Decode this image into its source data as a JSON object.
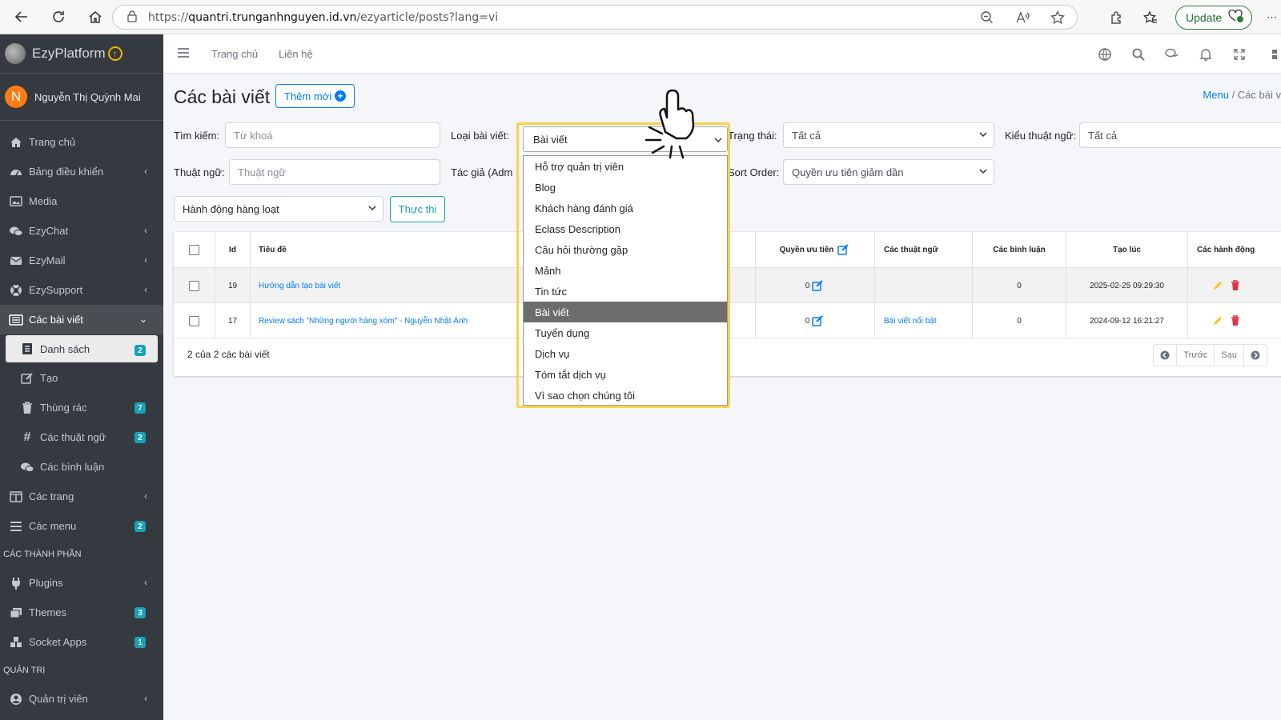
{
  "browser": {
    "url_prefix": "https://",
    "url_host": "quantri.trunganhnguyen.id.vn",
    "url_path": "/ezyarticle/posts?lang=vi",
    "update_label": "Update"
  },
  "sidebar": {
    "brand": "EzyPlatform",
    "user_initial": "N",
    "user_name": "Nguyễn Thị Quỳnh Mai",
    "items": [
      {
        "label": "Trang chủ",
        "icon": "home-icon"
      },
      {
        "label": "Bảng điều khiển",
        "icon": "dashboard-icon"
      },
      {
        "label": "Media",
        "icon": "image-icon"
      },
      {
        "label": "EzyChat",
        "icon": "chat-icon"
      },
      {
        "label": "EzyMail",
        "icon": "mail-icon"
      },
      {
        "label": "EzySupport",
        "icon": "support-icon"
      },
      {
        "label": "Các bài viết",
        "icon": "newspaper-icon"
      },
      {
        "label": "Danh sách",
        "icon": "list-icon",
        "badge": "2"
      },
      {
        "label": "Tạo",
        "icon": "edit-icon"
      },
      {
        "label": "Thùng rác",
        "icon": "trash-icon",
        "badge": "7"
      },
      {
        "label": "Các thuật ngữ",
        "icon": "hashtag-icon",
        "badge": "2"
      },
      {
        "label": "Các bình luận",
        "icon": "comments-icon"
      },
      {
        "label": "Các trang",
        "icon": "columns-icon"
      },
      {
        "label": "Các menu",
        "icon": "bars-icon",
        "badge": "2"
      },
      {
        "label": "Plugins",
        "icon": "plug-icon"
      },
      {
        "label": "Themes",
        "icon": "themes-icon",
        "badge": "3"
      },
      {
        "label": "Socket Apps",
        "icon": "cubes-icon",
        "badge": "1"
      },
      {
        "label": "Quản trị viên",
        "icon": "user-circle-icon"
      }
    ],
    "section_components": "CÁC THÀNH PHẦN",
    "section_admin": "QUẢN TRỊ"
  },
  "topnav": {
    "home": "Trang chủ",
    "contact": "Liên hệ"
  },
  "page": {
    "title": "Các bài viết",
    "add_new": "Thêm mới",
    "breadcrumb_menu": "Menu",
    "breadcrumb_current": "Các bài v"
  },
  "filters": {
    "search_label": "Tìm kiếm:",
    "search_placeholder": "Từ khoá",
    "type_label": "Loại bài viết:",
    "type_value": "Bài viết",
    "status_label": "Trạng thái:",
    "status_value": "Tất cả",
    "term_type_label": "Kiểu thuật ngữ:",
    "term_type_value": "Tất cả",
    "term_label": "Thuật ngữ:",
    "term_placeholder": "Thuật ngữ",
    "author_label": "Tác giả (Adm",
    "sort_label": "Sort Order:",
    "sort_value": "Quyền ưu tiên giảm dần",
    "bulk_action": "Hành động hàng loạt",
    "execute": "Thực thi"
  },
  "type_options": [
    "Hỗ trợ quản trị viên",
    "Blog",
    "Khách hàng đánh giá",
    "Eclass Description",
    "Câu hỏi thường gặp",
    "Mảnh",
    "Tin tức",
    "Bài viết",
    "Tuyển dụng",
    "Dịch vụ",
    "Tóm tắt dịch vụ",
    "Vì sao chọn chúng tôi"
  ],
  "selected_option": "Bài viết",
  "table": {
    "headers": {
      "id": "Id",
      "title": "Tiêu đề",
      "priority": "Quyền ưu tiên",
      "terms": "Các thuật ngữ",
      "comments": "Các bình luận",
      "created": "Tạo lúc",
      "actions": "Các hành động"
    },
    "rows": [
      {
        "id": "19",
        "title": "Hướng dẫn tạo bài viết",
        "priority": "0",
        "terms": "",
        "comments": "0",
        "created": "2025-02-25 09:29:30"
      },
      {
        "id": "17",
        "title": "Review sách \"Những người hàng xóm\" - Nguyễn Nhật Ánh",
        "priority": "0",
        "terms": "Bài viết nổi bật",
        "comments": "0",
        "created": "2024-09-12 16:21:27"
      }
    ],
    "summary": "2 của 2 các bài viết",
    "prev": "Trước",
    "next": "Sau"
  },
  "colors": {
    "sidebar_bg": "#343a40",
    "accent": "#007bff",
    "info": "#17a2b8",
    "highlight": "#f7d44a",
    "danger": "#dc3545",
    "warning": "#ffc107"
  }
}
